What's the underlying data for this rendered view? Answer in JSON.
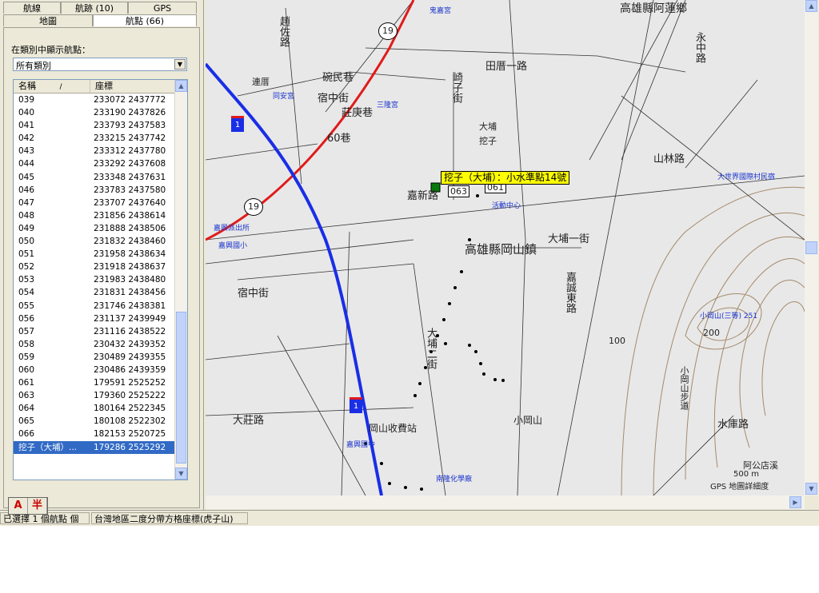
{
  "tabs_row1": [
    "航線",
    "航跡 (10)",
    "GPS"
  ],
  "tabs_row2": [
    "地圖",
    "航點 (66)"
  ],
  "category": {
    "label": "在類別中顯示航點：",
    "selected": "所有類別"
  },
  "list": {
    "col_name": "名稱",
    "col_coord": "座標",
    "rows": [
      {
        "name": "039",
        "coord": "233072 2437772"
      },
      {
        "name": "040",
        "coord": "233190 2437826"
      },
      {
        "name": "041",
        "coord": "233793 2437583"
      },
      {
        "name": "042",
        "coord": "233215 2437742"
      },
      {
        "name": "043",
        "coord": "233312 2437780"
      },
      {
        "name": "044",
        "coord": "233292 2437608"
      },
      {
        "name": "045",
        "coord": "233348 2437631"
      },
      {
        "name": "046",
        "coord": "233783 2437580"
      },
      {
        "name": "047",
        "coord": "233707 2437640"
      },
      {
        "name": "048",
        "coord": "231856 2438614"
      },
      {
        "name": "049",
        "coord": "231888 2438506"
      },
      {
        "name": "050",
        "coord": "231832 2438460"
      },
      {
        "name": "051",
        "coord": "231958 2438634"
      },
      {
        "name": "052",
        "coord": "231918 2438637"
      },
      {
        "name": "053",
        "coord": "231983 2438480"
      },
      {
        "name": "054",
        "coord": "231831 2438456"
      },
      {
        "name": "055",
        "coord": "231746 2438381"
      },
      {
        "name": "056",
        "coord": "231137 2439949"
      },
      {
        "name": "057",
        "coord": "231116 2438522"
      },
      {
        "name": "058",
        "coord": "230432 2439352"
      },
      {
        "name": "059",
        "coord": "230489 2439355"
      },
      {
        "name": "060",
        "coord": "230486 2439359"
      },
      {
        "name": "061",
        "coord": "179591 2525252"
      },
      {
        "name": "063",
        "coord": "179360 2525222"
      },
      {
        "name": "064",
        "coord": "180164 2522345"
      },
      {
        "name": "065",
        "coord": "180108 2522302"
      },
      {
        "name": "066",
        "coord": "182153 2520725"
      },
      {
        "name": "挖子（大埔）...",
        "coord": "179286 2525292",
        "selected": true
      }
    ]
  },
  "map": {
    "labels": {
      "region_top": "高雄縣阿蓮鄉",
      "town": "高雄縣岡山鎮",
      "road_19a": "19",
      "road_19b": "19",
      "hw1a": "1",
      "hw1b": "1",
      "tianliao": "田厝一路",
      "zhaozuo": "趙佐路",
      "yongzhong": "永中路",
      "shanlin": "山林路",
      "dapu1": "大埔一街",
      "dapu2": "大埔二街",
      "jiajian": "嘉誠東路",
      "jiaxin": "嘉新路",
      "suzhong": "宿中街",
      "dazhuang": "大莊路",
      "shuiku": "水庫路",
      "xiaogangshan": "小岡山",
      "xiaogangshan_peak": "小岡山(三等) 251",
      "xiaogangshan_trail": "小岡山步道",
      "gangshan_toll": "岡山收費站",
      "dapu": "大埔",
      "wazi": "挖子",
      "lianqiao": "連厝",
      "zuoxing": "宿中街",
      "zhuanjuan": "莊庚巷",
      "zhuang60": "60巷",
      "gaokou": "崎子街",
      "wanshi": "碗民巷",
      "n100": "100",
      "n200": "200",
      "agongdian": "阿公店溪",
      "gps_note": "GPS 地圖詳細度",
      "scale": "500 m",
      "popup": "挖子（大埔）：小水準點14號",
      "wp061": "061",
      "wp063": "063",
      "poi_temple1": "鬼嘉宮",
      "poi_temple2": "同安宮",
      "poi_temple3": "三隆宮",
      "poi_center": "活動中心",
      "poi_police": "嘉興派出所",
      "poi_school1": "嘉興國小",
      "poi_school2": "嘉興國中",
      "poi_factory": "南隆化學廠",
      "poi_village": "大世界國際村民宿"
    }
  },
  "status": {
    "selected": "已選擇 1 個航點",
    "count": "個",
    "grid": "台灣地區二度分帶方格座標(虎子山)"
  },
  "ime": {
    "a": "A",
    "b": "半"
  }
}
